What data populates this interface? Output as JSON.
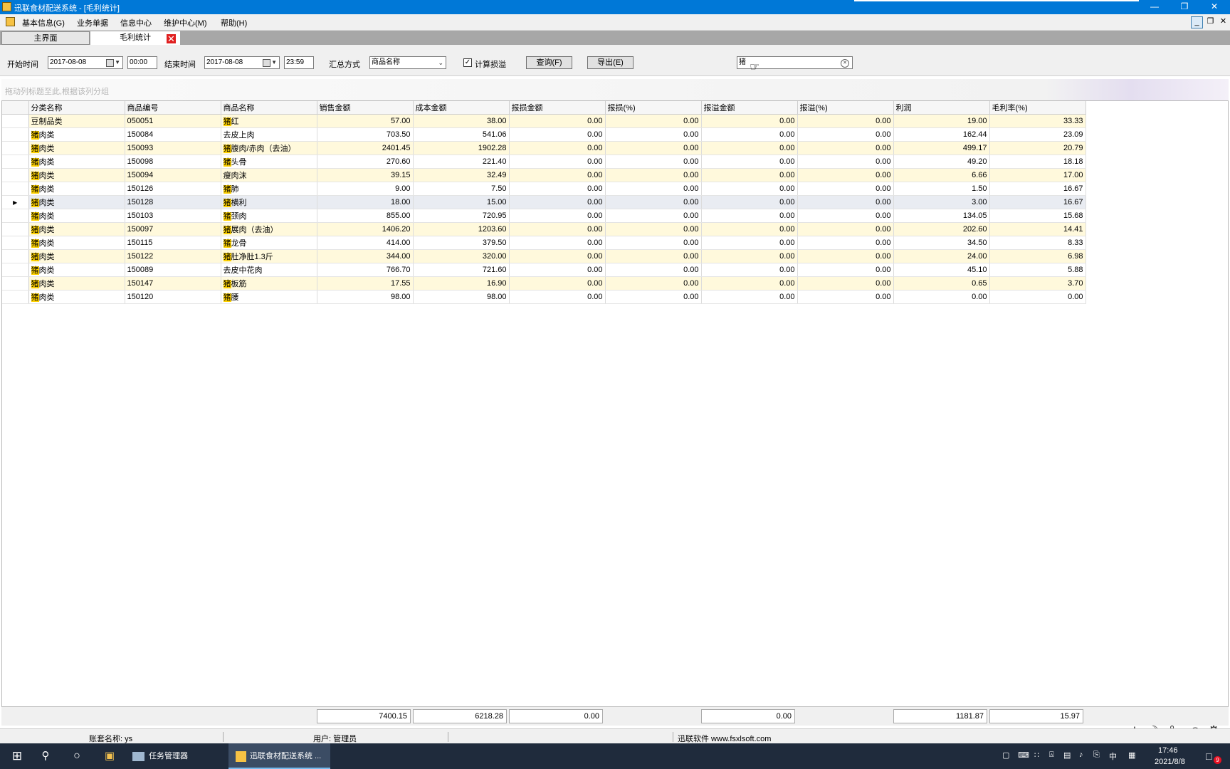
{
  "window": {
    "title": "迅联食材配送系统 - [毛利统计]"
  },
  "menu": [
    "基本信息(G)",
    "业务单据",
    "信息中心",
    "维护中心(M)",
    "帮助(H)"
  ],
  "tabs": [
    {
      "label": "主界面"
    },
    {
      "label": "毛利统计"
    }
  ],
  "filters": {
    "start_label": "开始时间",
    "start_date": "2017-08-08",
    "start_time": "00:00",
    "end_label": "结束时间",
    "end_date": "2017-08-08",
    "end_time": "23:59",
    "summary_label": "汇总方式",
    "summary_value": "商品名称",
    "calc_loss_label": "计算损溢",
    "calc_loss_checked": true,
    "query_button": "查询(F)",
    "export_button": "导出(E)",
    "search_value": "猪"
  },
  "group_hint": "拖动列标题至此,根据该列分组",
  "columns": [
    "分类名称",
    "商品编号",
    "商品名称",
    "销售金额",
    "成本金额",
    "报损金额",
    "报损(%)",
    "报溢金额",
    "报溢(%)",
    "利润",
    "毛利率(%)"
  ],
  "rows": [
    {
      "cat_hl": "",
      "cat": "豆制品类",
      "code": "050051",
      "name_hl": "猪",
      "name": "红",
      "sales": "57.00",
      "cost": "38.00",
      "loss": "0.00",
      "loss_pct": "0.00",
      "over": "0.00",
      "over_pct": "0.00",
      "profit": "19.00",
      "margin": "33.33"
    },
    {
      "cat_hl": "猪",
      "cat": "肉类",
      "code": "150084",
      "name_hl": "",
      "name": "去皮上肉",
      "sales": "703.50",
      "cost": "541.06",
      "loss": "0.00",
      "loss_pct": "0.00",
      "over": "0.00",
      "over_pct": "0.00",
      "profit": "162.44",
      "margin": "23.09"
    },
    {
      "cat_hl": "猪",
      "cat": "肉类",
      "code": "150093",
      "name_hl": "猪",
      "name": "腹肉/赤肉（去油）",
      "sales": "2401.45",
      "cost": "1902.28",
      "loss": "0.00",
      "loss_pct": "0.00",
      "over": "0.00",
      "over_pct": "0.00",
      "profit": "499.17",
      "margin": "20.79"
    },
    {
      "cat_hl": "猪",
      "cat": "肉类",
      "code": "150098",
      "name_hl": "猪",
      "name": "头骨",
      "sales": "270.60",
      "cost": "221.40",
      "loss": "0.00",
      "loss_pct": "0.00",
      "over": "0.00",
      "over_pct": "0.00",
      "profit": "49.20",
      "margin": "18.18"
    },
    {
      "cat_hl": "猪",
      "cat": "肉类",
      "code": "150094",
      "name_hl": "",
      "name": "瘦肉沫",
      "sales": "39.15",
      "cost": "32.49",
      "loss": "0.00",
      "loss_pct": "0.00",
      "over": "0.00",
      "over_pct": "0.00",
      "profit": "6.66",
      "margin": "17.00"
    },
    {
      "cat_hl": "猪",
      "cat": "肉类",
      "code": "150126",
      "name_hl": "猪",
      "name": "肺",
      "sales": "9.00",
      "cost": "7.50",
      "loss": "0.00",
      "loss_pct": "0.00",
      "over": "0.00",
      "over_pct": "0.00",
      "profit": "1.50",
      "margin": "16.67"
    },
    {
      "cat_hl": "猪",
      "cat": "肉类",
      "code": "150128",
      "name_hl": "猪",
      "name": "横利",
      "sales": "18.00",
      "cost": "15.00",
      "loss": "0.00",
      "loss_pct": "0.00",
      "over": "0.00",
      "over_pct": "0.00",
      "profit": "3.00",
      "margin": "16.67"
    },
    {
      "cat_hl": "猪",
      "cat": "肉类",
      "code": "150103",
      "name_hl": "猪",
      "name": "颈肉",
      "sales": "855.00",
      "cost": "720.95",
      "loss": "0.00",
      "loss_pct": "0.00",
      "over": "0.00",
      "over_pct": "0.00",
      "profit": "134.05",
      "margin": "15.68"
    },
    {
      "cat_hl": "猪",
      "cat": "肉类",
      "code": "150097",
      "name_hl": "猪",
      "name": "展肉（去油）",
      "sales": "1406.20",
      "cost": "1203.60",
      "loss": "0.00",
      "loss_pct": "0.00",
      "over": "0.00",
      "over_pct": "0.00",
      "profit": "202.60",
      "margin": "14.41"
    },
    {
      "cat_hl": "猪",
      "cat": "肉类",
      "code": "150115",
      "name_hl": "猪",
      "name": "龙骨",
      "sales": "414.00",
      "cost": "379.50",
      "loss": "0.00",
      "loss_pct": "0.00",
      "over": "0.00",
      "over_pct": "0.00",
      "profit": "34.50",
      "margin": "8.33"
    },
    {
      "cat_hl": "猪",
      "cat": "肉类",
      "code": "150122",
      "name_hl": "猪",
      "name": "肚净肚1.3斤",
      "sales": "344.00",
      "cost": "320.00",
      "loss": "0.00",
      "loss_pct": "0.00",
      "over": "0.00",
      "over_pct": "0.00",
      "profit": "24.00",
      "margin": "6.98"
    },
    {
      "cat_hl": "猪",
      "cat": "肉类",
      "code": "150089",
      "name_hl": "",
      "name": "去皮中花肉",
      "sales": "766.70",
      "cost": "721.60",
      "loss": "0.00",
      "loss_pct": "0.00",
      "over": "0.00",
      "over_pct": "0.00",
      "profit": "45.10",
      "margin": "5.88"
    },
    {
      "cat_hl": "猪",
      "cat": "肉类",
      "code": "150147",
      "name_hl": "猪",
      "name": "板筋",
      "sales": "17.55",
      "cost": "16.90",
      "loss": "0.00",
      "loss_pct": "0.00",
      "over": "0.00",
      "over_pct": "0.00",
      "profit": "0.65",
      "margin": "3.70"
    },
    {
      "cat_hl": "猪",
      "cat": "肉类",
      "code": "150120",
      "name_hl": "猪",
      "name": "腰",
      "sales": "98.00",
      "cost": "98.00",
      "loss": "0.00",
      "loss_pct": "0.00",
      "over": "0.00",
      "over_pct": "0.00",
      "profit": "0.00",
      "margin": "0.00"
    }
  ],
  "selected_row": 6,
  "totals": {
    "sales": "7400.15",
    "cost": "6218.28",
    "loss": "0.00",
    "over": "0.00",
    "profit": "1181.87",
    "margin": "15.97"
  },
  "status": {
    "account": "账套名称:  ys",
    "user": "用户:  管理员",
    "company": "迅联软件   www.fsxlsoft.com"
  },
  "ime": [
    "中",
    "☽",
    "°,",
    "☺",
    "⚙"
  ],
  "taskbar": {
    "items": [
      "任务管理器",
      "迅联食材配送系统 ..."
    ],
    "tray_ime": "中",
    "time": "17:46",
    "date": "2021/8/8",
    "notif_count": "9"
  },
  "colors": {
    "titlebar": "#0078d7",
    "highlight": "#ffd200",
    "alt_row": "#fff9dc",
    "taskbar": "#1f2b3c"
  }
}
